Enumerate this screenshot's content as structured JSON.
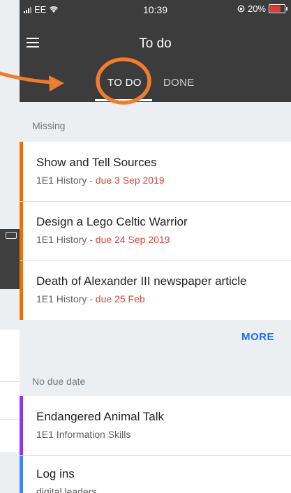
{
  "status": {
    "carrier": "EE",
    "time": "10:39",
    "battery_text": "20%",
    "battery_level": 0.2
  },
  "appbar": {
    "title": "To do",
    "tabs": [
      {
        "label": "TO DO",
        "selected": true
      },
      {
        "label": "DONE",
        "selected": false
      }
    ]
  },
  "sections": {
    "missing_label": "Missing",
    "no_due_label": "No due date",
    "more_label": "MORE"
  },
  "missing": [
    {
      "title": "Show and Tell Sources",
      "class": "1E1 History",
      "due": " - due 3 Sep 2019"
    },
    {
      "title": "Design a Lego Celtic Warrior",
      "class": "1E1 History",
      "due": " - due 24 Sep 2019"
    },
    {
      "title": "Death of Alexander III newspaper article",
      "class": "1E1 History",
      "due": " - due 25 Feb"
    }
  ],
  "no_due": [
    {
      "title": "Endangered Animal Talk",
      "class": "1E1 Information Skills"
    },
    {
      "title": "Log ins",
      "class": "digital leaders"
    }
  ],
  "colors": {
    "appbar": "#3c3c3c",
    "missing_stripe": "#e8710a",
    "no_due_stripe_1": "#9334e6",
    "no_due_stripe_2": "#4285f4",
    "due_text": "#d9473b",
    "more_link": "#1a73e8",
    "annotation": "#ef7d2d"
  }
}
